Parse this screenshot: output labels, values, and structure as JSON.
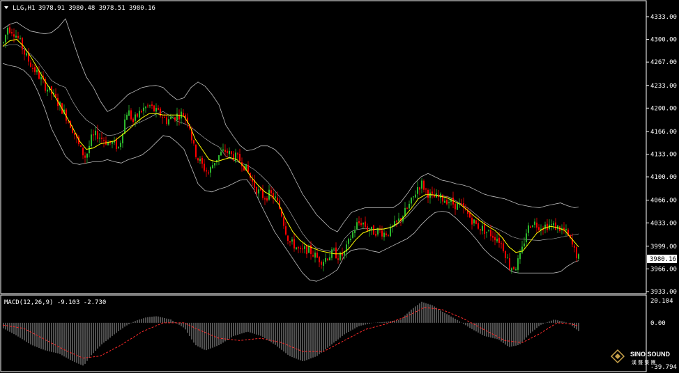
{
  "header": {
    "symbol_label": "LLG,H1",
    "ohlc": "3978.91 3980.48 3978.51 3980.16"
  },
  "macd": {
    "label": "MACD(12,26,9) -9.103 -2.730",
    "axis_labels": [
      "20.104",
      "0.00",
      "-39.794"
    ]
  },
  "price_axis": {
    "labels": [
      "4333.00",
      "4300.00",
      "4267.00",
      "4233.00",
      "4200.00",
      "4166.00",
      "4133.00",
      "4100.00",
      "4066.00",
      "4033.00",
      "3999.00",
      "3966.00",
      "3933.00"
    ],
    "current_price": "3980.16"
  },
  "watermark": {
    "brand": "SINO SOUND",
    "sub": "漢 聲 集 團"
  },
  "colors": {
    "bull": "#2db82d",
    "bear": "#ff0000",
    "ma": "#ffff00",
    "band": "#c0c0c0",
    "signal": "#ff2a2a",
    "histogram": "#c8c8c8"
  },
  "chart_data": {
    "type": "candlestick",
    "ylim": [
      3920,
      4350
    ],
    "price_track": [
      [
        0,
        4295
      ],
      [
        6,
        4318
      ],
      [
        14,
        4312
      ],
      [
        22,
        4300
      ],
      [
        30,
        4280
      ],
      [
        40,
        4262
      ],
      [
        50,
        4248
      ],
      [
        60,
        4232
      ],
      [
        70,
        4220
      ],
      [
        80,
        4205
      ],
      [
        90,
        4188
      ],
      [
        100,
        4168
      ],
      [
        110,
        4140
      ],
      [
        118,
        4128
      ],
      [
        126,
        4155
      ],
      [
        134,
        4162
      ],
      [
        142,
        4155
      ],
      [
        150,
        4150
      ],
      [
        158,
        4148
      ],
      [
        166,
        4142
      ],
      [
        172,
        4175
      ],
      [
        178,
        4198
      ],
      [
        186,
        4180
      ],
      [
        194,
        4192
      ],
      [
        202,
        4200
      ],
      [
        210,
        4203
      ],
      [
        218,
        4195
      ],
      [
        226,
        4190
      ],
      [
        234,
        4182
      ],
      [
        242,
        4186
      ],
      [
        250,
        4190
      ],
      [
        258,
        4192
      ],
      [
        266,
        4180
      ],
      [
        272,
        4145
      ],
      [
        278,
        4128
      ],
      [
        286,
        4115
      ],
      [
        294,
        4105
      ],
      [
        302,
        4122
      ],
      [
        310,
        4132
      ],
      [
        318,
        4138
      ],
      [
        326,
        4132
      ],
      [
        334,
        4128
      ],
      [
        342,
        4122
      ],
      [
        350,
        4108
      ],
      [
        358,
        4090
      ],
      [
        366,
        4078
      ],
      [
        374,
        4070
      ],
      [
        382,
        4075
      ],
      [
        390,
        4068
      ],
      [
        398,
        4050
      ],
      [
        404,
        4025
      ],
      [
        410,
        4005
      ],
      [
        418,
        4000
      ],
      [
        426,
        3990
      ],
      [
        434,
        3995
      ],
      [
        442,
        3990
      ],
      [
        450,
        3982
      ],
      [
        458,
        3978
      ],
      [
        466,
        3985
      ],
      [
        474,
        3990
      ],
      [
        482,
        3983
      ],
      [
        490,
        3990
      ],
      [
        498,
        4012
      ],
      [
        506,
        4030
      ],
      [
        514,
        4035
      ],
      [
        522,
        4025
      ],
      [
        530,
        4020
      ],
      [
        538,
        4022
      ],
      [
        546,
        4018
      ],
      [
        554,
        4020
      ],
      [
        562,
        4030
      ],
      [
        570,
        4040
      ],
      [
        578,
        4052
      ],
      [
        586,
        4065
      ],
      [
        594,
        4085
      ],
      [
        600,
        4090
      ],
      [
        606,
        4080
      ],
      [
        614,
        4070
      ],
      [
        622,
        4070
      ],
      [
        630,
        4068
      ],
      [
        638,
        4066
      ],
      [
        646,
        4060
      ],
      [
        654,
        4058
      ],
      [
        662,
        4050
      ],
      [
        670,
        4040
      ],
      [
        678,
        4030
      ],
      [
        686,
        4025
      ],
      [
        694,
        4020
      ],
      [
        702,
        4015
      ],
      [
        710,
        4010
      ],
      [
        718,
        3995
      ],
      [
        726,
        3970
      ],
      [
        734,
        3968
      ],
      [
        742,
        3985
      ],
      [
        750,
        4020
      ],
      [
        758,
        4035
      ],
      [
        766,
        4030
      ],
      [
        774,
        4028
      ],
      [
        782,
        4030
      ],
      [
        790,
        4028
      ],
      [
        798,
        4025
      ],
      [
        806,
        4020
      ],
      [
        814,
        4005
      ],
      [
        820,
        3990
      ],
      [
        826,
        3980
      ]
    ],
    "ma_track": [
      [
        0,
        4290
      ],
      [
        10,
        4298
      ],
      [
        20,
        4300
      ],
      [
        30,
        4290
      ],
      [
        40,
        4275
      ],
      [
        50,
        4258
      ],
      [
        60,
        4240
      ],
      [
        70,
        4225
      ],
      [
        80,
        4208
      ],
      [
        90,
        4190
      ],
      [
        100,
        4172
      ],
      [
        110,
        4152
      ],
      [
        120,
        4140
      ],
      [
        130,
        4142
      ],
      [
        140,
        4148
      ],
      [
        150,
        4150
      ],
      [
        160,
        4152
      ],
      [
        170,
        4160
      ],
      [
        180,
        4168
      ],
      [
        190,
        4178
      ],
      [
        200,
        4186
      ],
      [
        210,
        4192
      ],
      [
        220,
        4192
      ],
      [
        230,
        4190
      ],
      [
        240,
        4190
      ],
      [
        250,
        4190
      ],
      [
        260,
        4188
      ],
      [
        268,
        4175
      ],
      [
        276,
        4155
      ],
      [
        286,
        4140
      ],
      [
        296,
        4125
      ],
      [
        306,
        4122
      ],
      [
        316,
        4125
      ],
      [
        326,
        4128
      ],
      [
        336,
        4125
      ],
      [
        346,
        4115
      ],
      [
        356,
        4100
      ],
      [
        366,
        4088
      ],
      [
        376,
        4078
      ],
      [
        386,
        4072
      ],
      [
        396,
        4060
      ],
      [
        406,
        4038
      ],
      [
        416,
        4020
      ],
      [
        426,
        4008
      ],
      [
        436,
        4000
      ],
      [
        446,
        3996
      ],
      [
        456,
        3992
      ],
      [
        466,
        3990
      ],
      [
        476,
        3988
      ],
      [
        486,
        3988
      ],
      [
        496,
        3995
      ],
      [
        506,
        4008
      ],
      [
        516,
        4018
      ],
      [
        526,
        4022
      ],
      [
        536,
        4024
      ],
      [
        546,
        4024
      ],
      [
        556,
        4026
      ],
      [
        566,
        4032
      ],
      [
        576,
        4042
      ],
      [
        586,
        4054
      ],
      [
        596,
        4068
      ],
      [
        606,
        4074
      ],
      [
        616,
        4074
      ],
      [
        626,
        4072
      ],
      [
        636,
        4070
      ],
      [
        646,
        4065
      ],
      [
        656,
        4060
      ],
      [
        666,
        4052
      ],
      [
        676,
        4043
      ],
      [
        686,
        4035
      ],
      [
        696,
        4028
      ],
      [
        706,
        4022
      ],
      [
        716,
        4012
      ],
      [
        726,
        3998
      ],
      [
        736,
        3990
      ],
      [
        746,
        3992
      ],
      [
        756,
        4005
      ],
      [
        766,
        4018
      ],
      [
        776,
        4025
      ],
      [
        786,
        4028
      ],
      [
        796,
        4026
      ],
      [
        806,
        4022
      ],
      [
        816,
        4010
      ],
      [
        826,
        3998
      ]
    ],
    "upper_band": [
      [
        0,
        4315
      ],
      [
        10,
        4322
      ],
      [
        20,
        4325
      ],
      [
        30,
        4318
      ],
      [
        40,
        4312
      ],
      [
        50,
        4310
      ],
      [
        60,
        4308
      ],
      [
        70,
        4310
      ],
      [
        80,
        4318
      ],
      [
        90,
        4330
      ],
      [
        100,
        4300
      ],
      [
        110,
        4270
      ],
      [
        120,
        4245
      ],
      [
        130,
        4230
      ],
      [
        140,
        4210
      ],
      [
        150,
        4195
      ],
      [
        160,
        4200
      ],
      [
        170,
        4210
      ],
      [
        180,
        4220
      ],
      [
        190,
        4225
      ],
      [
        200,
        4230
      ],
      [
        210,
        4232
      ],
      [
        220,
        4233
      ],
      [
        230,
        4230
      ],
      [
        240,
        4220
      ],
      [
        250,
        4212
      ],
      [
        260,
        4215
      ],
      [
        270,
        4230
      ],
      [
        280,
        4238
      ],
      [
        290,
        4232
      ],
      [
        300,
        4220
      ],
      [
        310,
        4205
      ],
      [
        320,
        4175
      ],
      [
        330,
        4160
      ],
      [
        340,
        4146
      ],
      [
        350,
        4138
      ],
      [
        360,
        4140
      ],
      [
        370,
        4145
      ],
      [
        380,
        4145
      ],
      [
        390,
        4140
      ],
      [
        400,
        4130
      ],
      [
        410,
        4115
      ],
      [
        420,
        4095
      ],
      [
        430,
        4075
      ],
      [
        440,
        4060
      ],
      [
        450,
        4045
      ],
      [
        460,
        4035
      ],
      [
        470,
        4025
      ],
      [
        480,
        4020
      ],
      [
        490,
        4035
      ],
      [
        500,
        4048
      ],
      [
        510,
        4052
      ],
      [
        520,
        4055
      ],
      [
        530,
        4055
      ],
      [
        540,
        4055
      ],
      [
        550,
        4055
      ],
      [
        560,
        4055
      ],
      [
        570,
        4062
      ],
      [
        580,
        4075
      ],
      [
        590,
        4090
      ],
      [
        600,
        4100
      ],
      [
        610,
        4105
      ],
      [
        620,
        4100
      ],
      [
        630,
        4095
      ],
      [
        640,
        4093
      ],
      [
        650,
        4090
      ],
      [
        660,
        4088
      ],
      [
        670,
        4085
      ],
      [
        680,
        4080
      ],
      [
        690,
        4075
      ],
      [
        700,
        4072
      ],
      [
        710,
        4070
      ],
      [
        720,
        4068
      ],
      [
        730,
        4064
      ],
      [
        740,
        4060
      ],
      [
        750,
        4058
      ],
      [
        760,
        4056
      ],
      [
        770,
        4055
      ],
      [
        780,
        4058
      ],
      [
        790,
        4060
      ],
      [
        800,
        4062
      ],
      [
        810,
        4058
      ],
      [
        820,
        4055
      ],
      [
        826,
        4056
      ]
    ],
    "lower_band": [
      [
        0,
        4265
      ],
      [
        10,
        4262
      ],
      [
        20,
        4260
      ],
      [
        30,
        4255
      ],
      [
        40,
        4245
      ],
      [
        50,
        4225
      ],
      [
        60,
        4200
      ],
      [
        70,
        4170
      ],
      [
        80,
        4150
      ],
      [
        90,
        4130
      ],
      [
        100,
        4120
      ],
      [
        110,
        4118
      ],
      [
        120,
        4120
      ],
      [
        130,
        4122
      ],
      [
        140,
        4122
      ],
      [
        150,
        4125
      ],
      [
        160,
        4122
      ],
      [
        170,
        4120
      ],
      [
        180,
        4125
      ],
      [
        190,
        4128
      ],
      [
        200,
        4132
      ],
      [
        210,
        4140
      ],
      [
        220,
        4150
      ],
      [
        230,
        4160
      ],
      [
        240,
        4158
      ],
      [
        250,
        4150
      ],
      [
        260,
        4140
      ],
      [
        270,
        4115
      ],
      [
        280,
        4090
      ],
      [
        290,
        4080
      ],
      [
        300,
        4078
      ],
      [
        310,
        4082
      ],
      [
        320,
        4085
      ],
      [
        330,
        4090
      ],
      [
        340,
        4095
      ],
      [
        350,
        4096
      ],
      [
        360,
        4082
      ],
      [
        370,
        4060
      ],
      [
        380,
        4040
      ],
      [
        390,
        4020
      ],
      [
        400,
        4005
      ],
      [
        410,
        3990
      ],
      [
        420,
        3975
      ],
      [
        430,
        3960
      ],
      [
        440,
        3950
      ],
      [
        450,
        3948
      ],
      [
        460,
        3952
      ],
      [
        470,
        3958
      ],
      [
        480,
        3965
      ],
      [
        490,
        3985
      ],
      [
        500,
        3993
      ],
      [
        510,
        3995
      ],
      [
        520,
        3995
      ],
      [
        530,
        3992
      ],
      [
        540,
        3990
      ],
      [
        550,
        3995
      ],
      [
        560,
        4000
      ],
      [
        570,
        4005
      ],
      [
        580,
        4010
      ],
      [
        590,
        4018
      ],
      [
        600,
        4030
      ],
      [
        610,
        4040
      ],
      [
        620,
        4048
      ],
      [
        630,
        4050
      ],
      [
        640,
        4048
      ],
      [
        650,
        4040
      ],
      [
        660,
        4030
      ],
      [
        670,
        4020
      ],
      [
        680,
        4008
      ],
      [
        690,
        3995
      ],
      [
        700,
        3985
      ],
      [
        710,
        3978
      ],
      [
        720,
        3970
      ],
      [
        730,
        3962
      ],
      [
        740,
        3960
      ],
      [
        750,
        3960
      ],
      [
        760,
        3960
      ],
      [
        770,
        3960
      ],
      [
        780,
        3960
      ],
      [
        790,
        3960
      ],
      [
        800,
        3962
      ],
      [
        810,
        3970
      ],
      [
        820,
        3976
      ],
      [
        826,
        3978
      ]
    ],
    "macd_hist_track": [
      [
        0,
        -5
      ],
      [
        20,
        -12
      ],
      [
        40,
        -20
      ],
      [
        60,
        -25
      ],
      [
        80,
        -28
      ],
      [
        100,
        -35
      ],
      [
        115,
        -39
      ],
      [
        125,
        -30
      ],
      [
        140,
        -20
      ],
      [
        160,
        -10
      ],
      [
        175,
        -3
      ],
      [
        190,
        2
      ],
      [
        205,
        5
      ],
      [
        220,
        6
      ],
      [
        240,
        3
      ],
      [
        260,
        -5
      ],
      [
        275,
        -20
      ],
      [
        290,
        -25
      ],
      [
        310,
        -20
      ],
      [
        330,
        -12
      ],
      [
        350,
        -8
      ],
      [
        370,
        -12
      ],
      [
        390,
        -20
      ],
      [
        410,
        -30
      ],
      [
        430,
        -35
      ],
      [
        450,
        -30
      ],
      [
        470,
        -20
      ],
      [
        490,
        -10
      ],
      [
        510,
        -3
      ],
      [
        530,
        0
      ],
      [
        550,
        1
      ],
      [
        570,
        3
      ],
      [
        585,
        12
      ],
      [
        600,
        19
      ],
      [
        615,
        16
      ],
      [
        630,
        10
      ],
      [
        650,
        3
      ],
      [
        670,
        -5
      ],
      [
        690,
        -12
      ],
      [
        710,
        -15
      ],
      [
        725,
        -22
      ],
      [
        740,
        -20
      ],
      [
        755,
        -10
      ],
      [
        770,
        -2
      ],
      [
        790,
        3
      ],
      [
        810,
        0
      ],
      [
        826,
        -8
      ]
    ],
    "macd_signal_track": [
      [
        0,
        -2
      ],
      [
        30,
        -5
      ],
      [
        60,
        -15
      ],
      [
        90,
        -25
      ],
      [
        115,
        -32
      ],
      [
        140,
        -30
      ],
      [
        170,
        -20
      ],
      [
        200,
        -8
      ],
      [
        230,
        0
      ],
      [
        260,
        0
      ],
      [
        280,
        -6
      ],
      [
        310,
        -14
      ],
      [
        340,
        -16
      ],
      [
        370,
        -14
      ],
      [
        400,
        -18
      ],
      [
        430,
        -26
      ],
      [
        460,
        -26
      ],
      [
        490,
        -16
      ],
      [
        520,
        -6
      ],
      [
        550,
        -1
      ],
      [
        580,
        6
      ],
      [
        605,
        14
      ],
      [
        630,
        12
      ],
      [
        660,
        4
      ],
      [
        690,
        -6
      ],
      [
        720,
        -16
      ],
      [
        745,
        -18
      ],
      [
        770,
        -10
      ],
      [
        795,
        0
      ],
      [
        815,
        -1
      ],
      [
        826,
        -3
      ]
    ]
  }
}
